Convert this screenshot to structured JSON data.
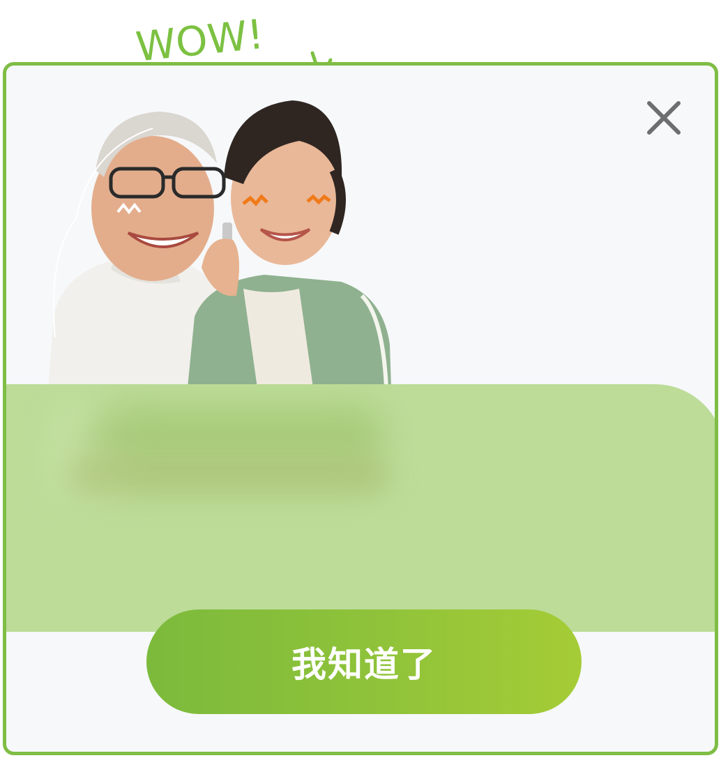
{
  "header_doodle": {
    "text": "WOW!",
    "color": "#7cc142"
  },
  "dialog": {
    "border_color": "#7fbd45",
    "background": "#f6f8fa",
    "close_icon": "close-icon",
    "panel_color": "#bcdc98",
    "confirm_button": {
      "label": "我知道了",
      "gradient_start": "#7cba3c",
      "gradient_end": "#a5cc36"
    }
  }
}
